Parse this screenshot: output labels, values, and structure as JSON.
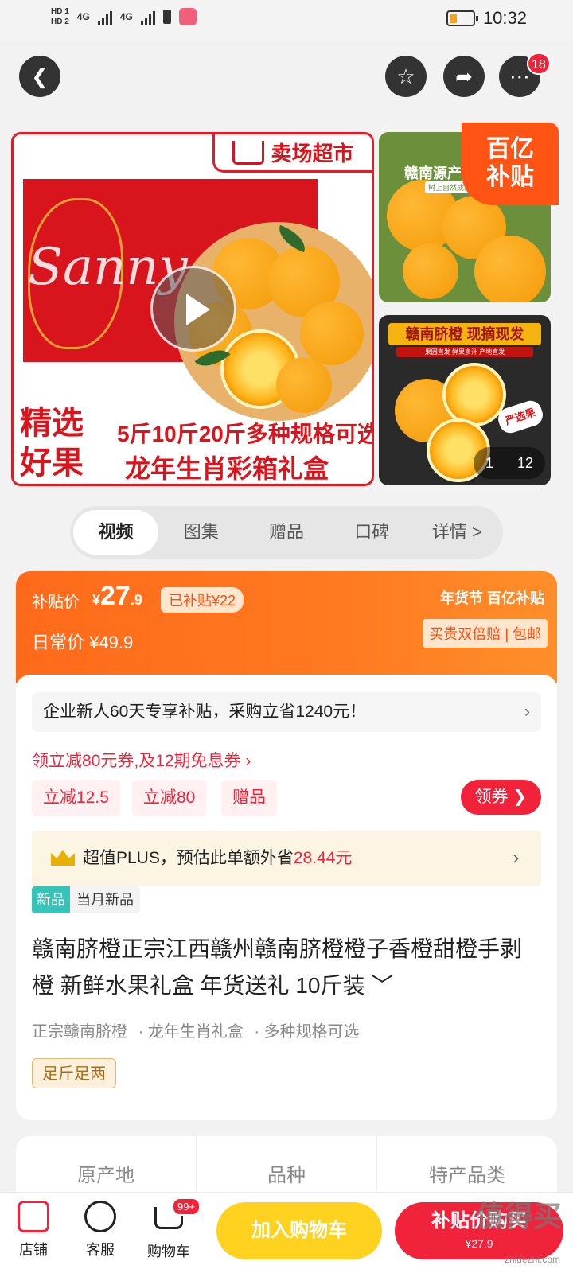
{
  "status": {
    "network": [
      "HD 1",
      "HD 2",
      "4G",
      "4G"
    ],
    "time": "10:32"
  },
  "nav": {
    "notification_count": "18"
  },
  "gallery": {
    "main_banner": "卖场超市",
    "watermark_script": "Sanny",
    "corner_text": [
      "精选",
      "好果"
    ],
    "spec_text": "5斤10斤20斤多种规格可选",
    "gift_text": "龙年生肖彩箱礼盒",
    "side1_title": "赣南源产",
    "side1_sub": "树上自然成熟",
    "side2_title": "赣南脐橙 现摘现发",
    "side2_sub": "果园直发 鲜果多汁 产地直发",
    "side2_badge": "严选果",
    "subsidy_corner": [
      "百亿",
      "补贴"
    ],
    "page_current": "1",
    "page_total": "12"
  },
  "media_tabs": [
    "视频",
    "图集",
    "赠品",
    "口碑",
    "详情 >"
  ],
  "price": {
    "subsidy_label": "补贴价",
    "currency": "¥",
    "subsidy_int": "27",
    "subsidy_dec": ".9",
    "already_subsidy": "已补贴¥22",
    "daily_label": "日常价",
    "daily_price": "¥49.9",
    "brand": "年货节 百亿补贴",
    "guarantee": "买贵双倍赔 | 包邮"
  },
  "promo": {
    "enterprise": "企业新人60天专享补贴，采购立省1240元！",
    "coupon_link": "领立减80元券,及12期免息券 ›",
    "chips": [
      "立减12.5",
      "立减80",
      "赠品"
    ],
    "get_coupon": "领券 ❯",
    "plus_text": "超值PLUS，预估此单额外省",
    "plus_amount": "28.44元",
    "new_tag": "新品",
    "new_tag_desc": "当月新品"
  },
  "product": {
    "title": "赣南脐橙正宗江西赣州赣南脐橙橙子香橙甜橙手剥橙 新鲜水果礼盒 年货送礼 10斤装 ﹀",
    "attrs": [
      "正宗赣南脐橙",
      "· 龙年生肖礼盒",
      "· 多种规格可选"
    ],
    "badge": "足斤足两"
  },
  "specs": [
    "原产地",
    "品种",
    "特产品类"
  ],
  "bottom": {
    "shop": "店铺",
    "service": "客服",
    "cart": "购物车",
    "cart_badge": "99+",
    "add_cart": "加入购物车",
    "buy": "补贴价购买",
    "buy_price": "¥27.9"
  },
  "watermark": {
    "main": "值得买",
    "url": "zhidezhi.com"
  }
}
